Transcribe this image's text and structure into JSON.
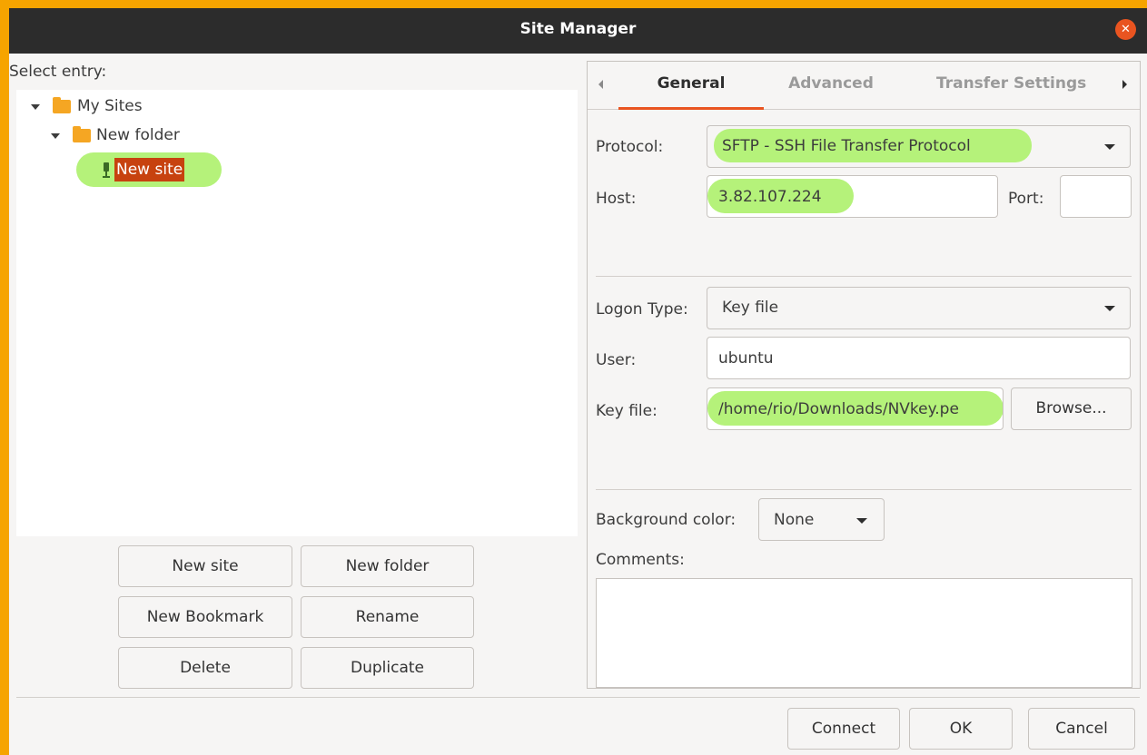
{
  "window": {
    "title": "Site Manager"
  },
  "tree": {
    "select_entry_label": "Select entry:",
    "items": [
      {
        "label": "My Sites"
      },
      {
        "label": "New folder"
      },
      {
        "label": "New site"
      }
    ]
  },
  "tree_buttons": {
    "new_site": "New site",
    "new_folder": "New folder",
    "new_bookmark": "New Bookmark",
    "rename": "Rename",
    "delete": "Delete",
    "duplicate": "Duplicate"
  },
  "tabs": [
    {
      "label": "General"
    },
    {
      "label": "Advanced"
    },
    {
      "label": "Transfer Settings"
    }
  ],
  "general": {
    "protocol_label": "Protocol:",
    "protocol_value": "SFTP - SSH File Transfer Protocol",
    "host_label": "Host:",
    "host_value": "3.82.107.224",
    "port_label": "Port:",
    "port_value": "",
    "logon_type_label": "Logon Type:",
    "logon_type_value": "Key file",
    "user_label": "User:",
    "user_value": "ubuntu",
    "key_file_label": "Key file:",
    "key_file_value": "/home/rio/Downloads/NVkey.pe",
    "browse_label": "Browse...",
    "background_color_label": "Background color:",
    "background_color_value": "None",
    "comments_label": "Comments:",
    "comments_value": ""
  },
  "footer": {
    "connect": "Connect",
    "ok": "OK",
    "cancel": "Cancel"
  },
  "colors": {
    "frame": "#f6a400",
    "titlebar": "#2c2c2c",
    "accent": "#e95420",
    "highlight": "#b5f27a",
    "selection": "#c7420f"
  }
}
